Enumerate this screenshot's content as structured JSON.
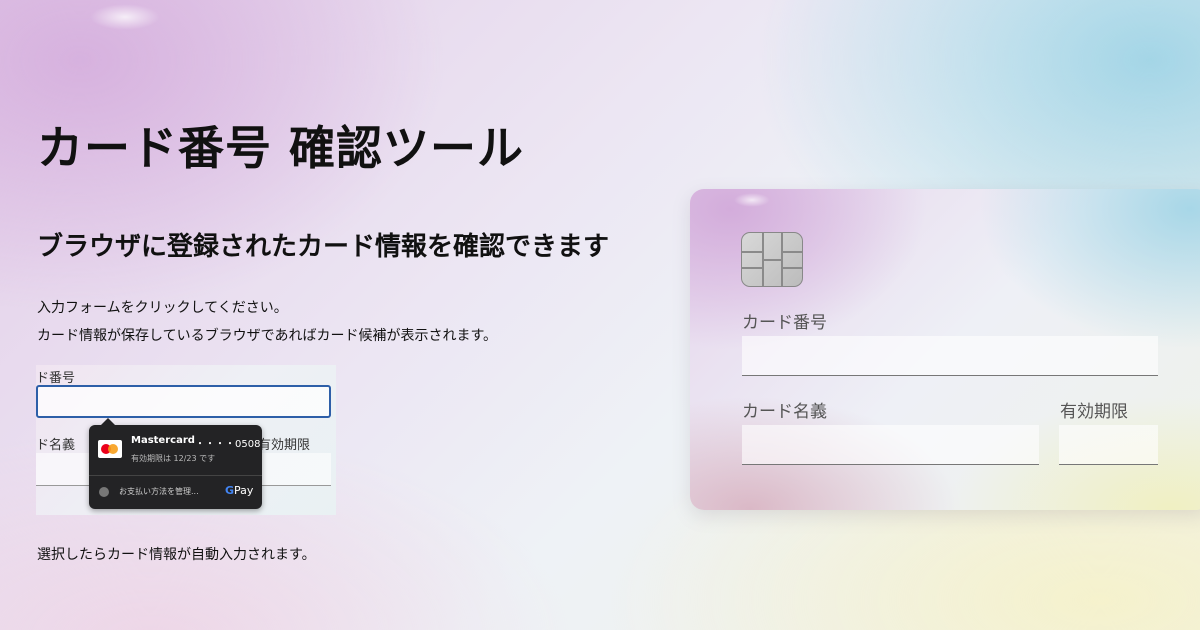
{
  "page": {
    "title": "カード番号 確認ツール",
    "subtitle": "ブラウザに登録されたカード情報を確認できます",
    "instructions": [
      "入力フォームをクリックしてください。",
      "カード情報が保存しているブラウザであればカード候補が表示されます。"
    ],
    "footer_note": "選択したらカード情報が自動入力されます。"
  },
  "example": {
    "card_number_label": "ド番号",
    "card_name_label": "ド名義",
    "expiry_label": "有効期限",
    "autofill": {
      "brand": "Mastercard",
      "last_digits": "・・・・0508",
      "expiry_text": "有効期限は 12/23 です",
      "manage_text": "お支払い方法を管理...",
      "gpay_g": "G",
      "gpay_text": "Pay",
      "card_icon": "mastercard-icon",
      "manage_icon": "settings-icon"
    }
  },
  "card_form": {
    "card_number_label": "カード番号",
    "card_name_label": "カード名義",
    "expiry_label": "有効期限",
    "chip_icon": "card-chip-icon",
    "card_number_value": "",
    "card_name_value": "",
    "expiry_value": ""
  },
  "colors": {
    "focus_border": "#2d5fa8",
    "popup_bg": "#232325",
    "mastercard_red": "#eb001b",
    "mastercard_orange": "#f79e1b"
  }
}
